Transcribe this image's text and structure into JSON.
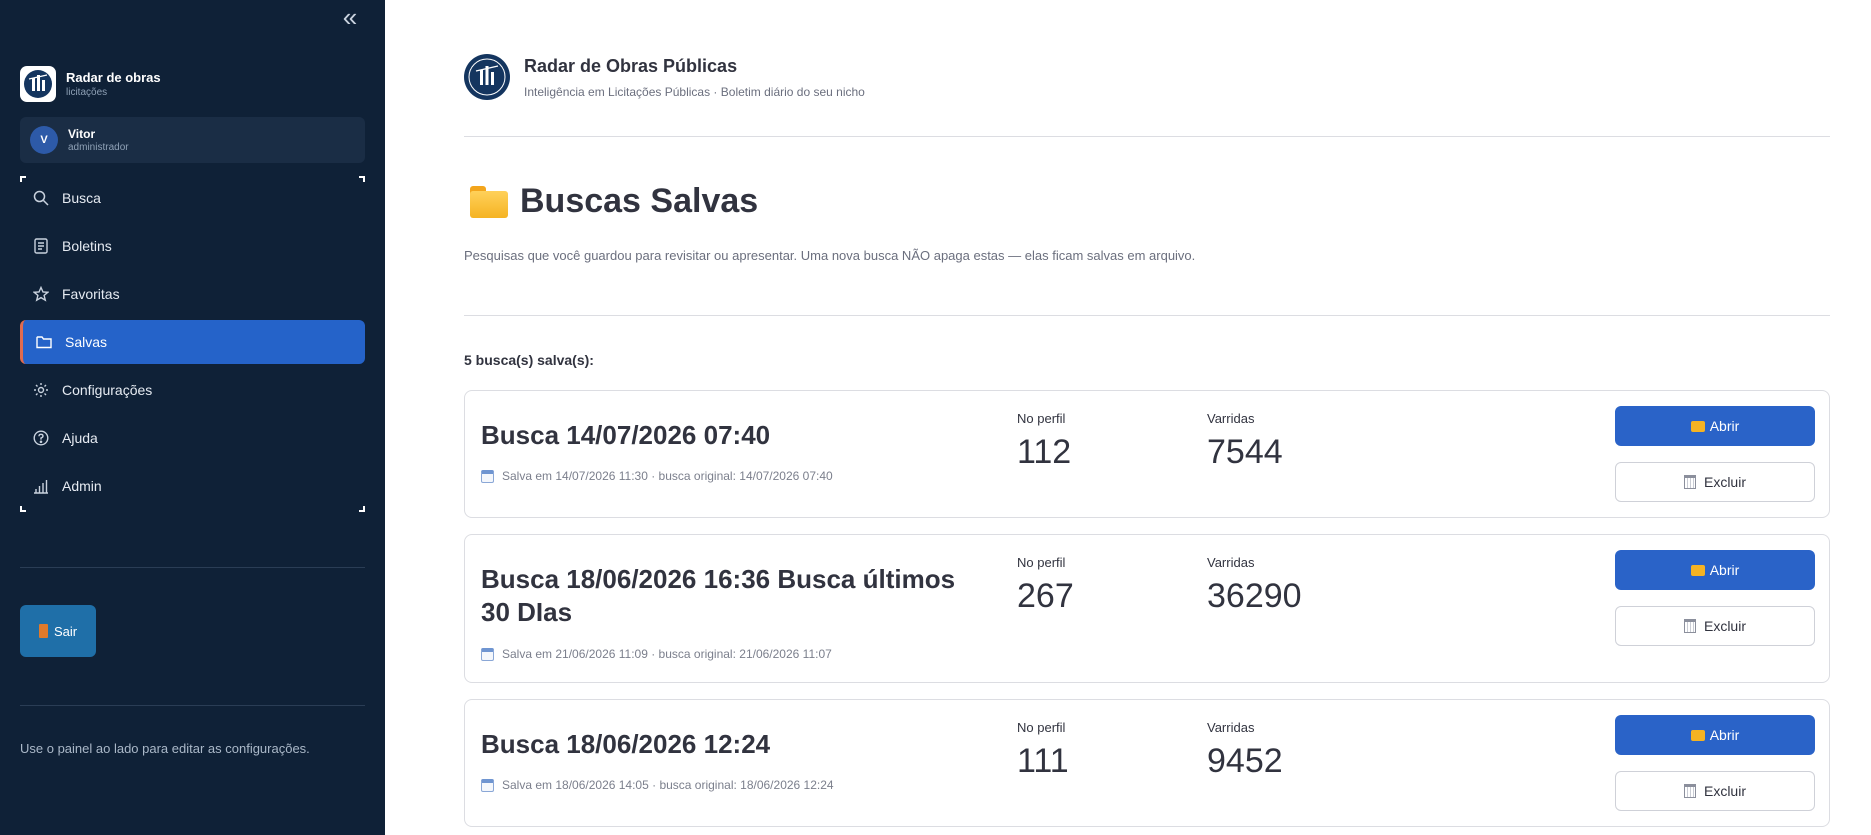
{
  "sidebar": {
    "collapse_icon": "double-chevron-left-icon",
    "brand": {
      "name": "Radar de obras",
      "subtitle": "licitações"
    },
    "user": {
      "initial": "V",
      "name": "Vitor",
      "role": "administrador"
    },
    "nav": [
      {
        "label": "Busca",
        "icon": "search-icon"
      },
      {
        "label": "Boletins",
        "icon": "document-icon"
      },
      {
        "label": "Favoritas",
        "icon": "star-icon"
      },
      {
        "label": "Salvas",
        "icon": "folder-icon",
        "active": true
      },
      {
        "label": "Configurações",
        "icon": "gear-icon"
      },
      {
        "label": "Ajuda",
        "icon": "help-icon"
      },
      {
        "label": "Admin",
        "icon": "chart-bars-icon"
      }
    ],
    "logout_label": "Sair",
    "note": "Use o painel ao lado para editar as configurações."
  },
  "header": {
    "title": "Radar de Obras Públicas",
    "subtitle": "Inteligência em Licitações Públicas · Boletim diário do seu nicho"
  },
  "page": {
    "title": "Buscas Salvas",
    "description": "Pesquisas que você guardou para revisitar ou apresentar. Uma nova busca NÃO apaga estas — elas ficam salvas em arquivo.",
    "count_label": "5 busca(s) salva(s):"
  },
  "labels": {
    "in_profile": "No perfil",
    "scanned": "Varridas",
    "open": "Abrir",
    "delete": "Excluir"
  },
  "saved_searches": [
    {
      "title": "Busca 14/07/2026 07:40",
      "meta": "Salva em 14/07/2026 11:30 · busca original: 14/07/2026 07:40",
      "in_profile": "112",
      "scanned": "7544"
    },
    {
      "title": "Busca 18/06/2026 16:36 Busca últimos 30 DIas",
      "meta": "Salva em 21/06/2026 11:09 · busca original: 21/06/2026 11:07",
      "in_profile": "267",
      "scanned": "36290"
    },
    {
      "title": "Busca 18/06/2026 12:24",
      "meta": "Salva em 18/06/2026 14:05 · busca original: 18/06/2026 12:24",
      "in_profile": "111",
      "scanned": "9452"
    }
  ],
  "colors": {
    "sidebar_bg": "#0f2137",
    "accent_blue": "#2a63c8",
    "active_nav": "#2563c9",
    "active_marker": "#e06b4f"
  }
}
